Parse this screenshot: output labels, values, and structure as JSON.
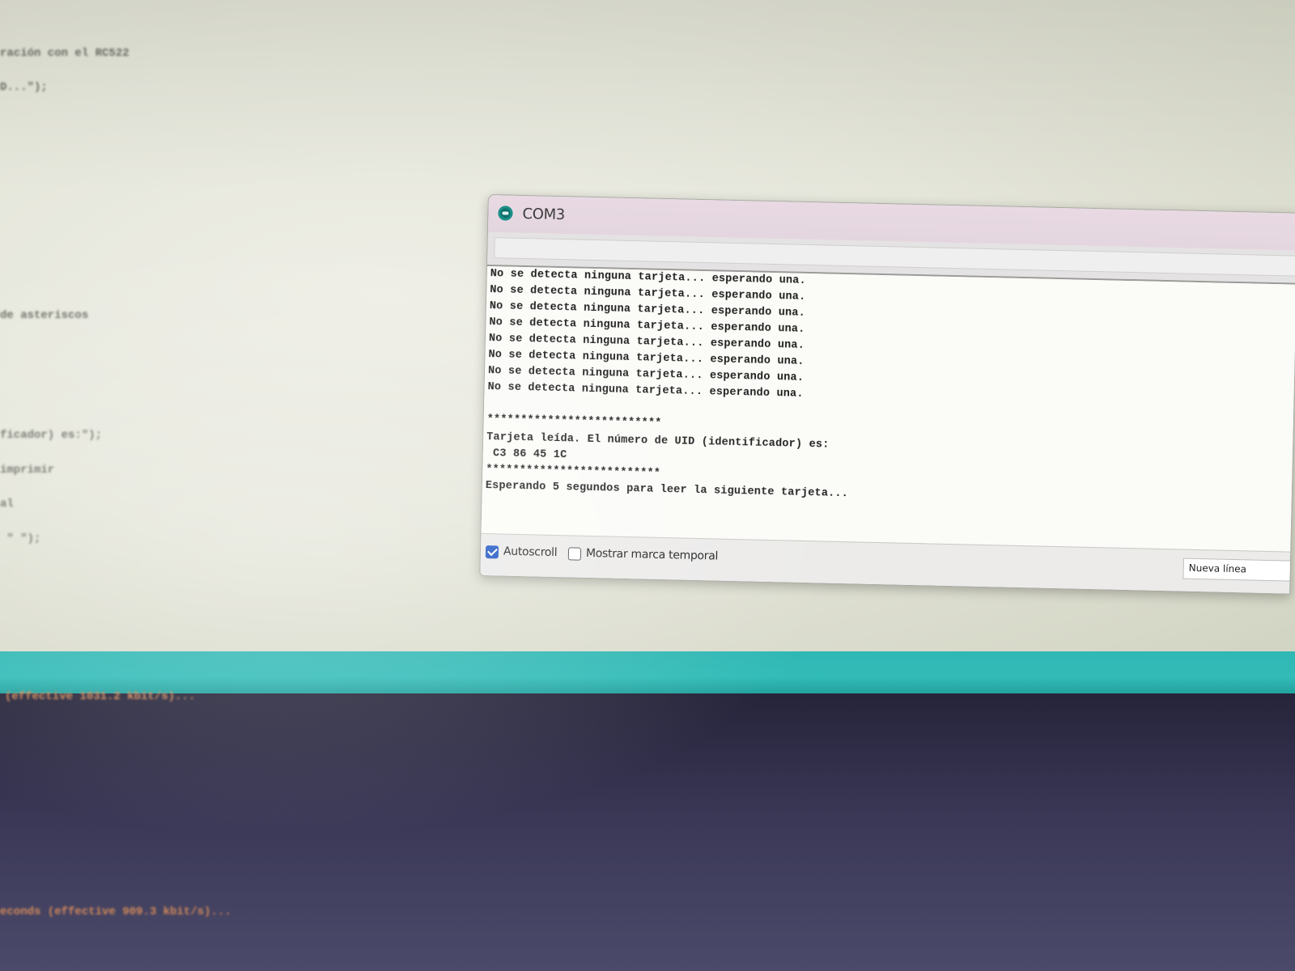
{
  "editor": {
    "code_lines": [
      "ración con el RC522",
      "D...\");",
      "de asteriscos",
      "ficador) es:\");",
      "imprimir",
      "al",
      " \" \");"
    ]
  },
  "console": {
    "lines": [
      "(effective 1031.2 kbit/s)...",
      "econds (effective 909.3 kbit/s)..."
    ]
  },
  "serial_monitor": {
    "title": "COM3",
    "send_input": {
      "value": "",
      "placeholder": ""
    },
    "output_lines": [
      "No se detecta ninguna tarjeta... esperando una.",
      "No se detecta ninguna tarjeta... esperando una.",
      "No se detecta ninguna tarjeta... esperando una.",
      "No se detecta ninguna tarjeta... esperando una.",
      "No se detecta ninguna tarjeta... esperando una.",
      "No se detecta ninguna tarjeta... esperando una.",
      "No se detecta ninguna tarjeta... esperando una.",
      "No se detecta ninguna tarjeta... esperando una.",
      "",
      "**************************",
      "Tarjeta leída. El número de UID (identificador) es:",
      " C3 86 45 1C",
      "**************************",
      "Esperando 5 segundos para leer la siguiente tarjeta..."
    ],
    "autoscroll": {
      "label": "Autoscroll",
      "checked": true
    },
    "timestamp": {
      "label": "Mostrar marca temporal",
      "checked": false
    },
    "line_ending": {
      "selected": "Nueva línea"
    }
  },
  "colors": {
    "teal_bar": "#32bcb8",
    "console_bg": "#3a3856",
    "console_text": "#d38a5a",
    "checkbox_checked": "#1f56c4",
    "title_bar": "#e6d8e1"
  },
  "icons": {
    "app_icon": "arduino-icon"
  }
}
